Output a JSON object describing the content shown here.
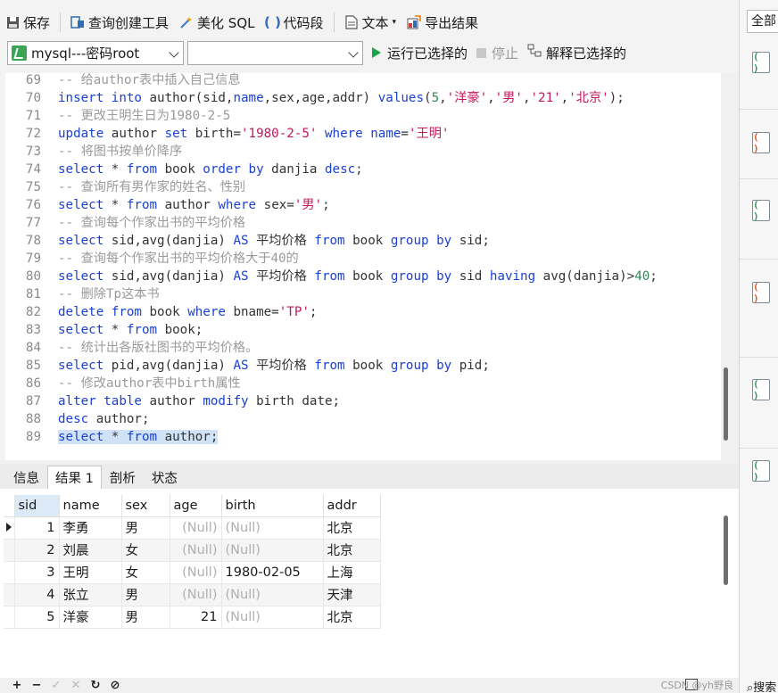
{
  "toolbar": {
    "save": "保存",
    "query_builder": "查询创建工具",
    "beautify_sql": "美化 SQL",
    "code_snippet": "代码段",
    "text": "文本",
    "export_result": "导出结果",
    "connection": "mysql---密码root",
    "database": "",
    "run_selected": "运行已选择的",
    "stop": "停止",
    "explain_selected": "解释已选择的"
  },
  "editor": {
    "lines": [
      {
        "n": "69",
        "tokens": [
          {
            "t": "-- 给author表中插入自己信息",
            "c": "cm"
          }
        ]
      },
      {
        "n": "70",
        "tokens": [
          {
            "t": "insert",
            "c": "kw"
          },
          {
            "t": " ",
            "c": "id"
          },
          {
            "t": "into",
            "c": "kw"
          },
          {
            "t": " author(sid,",
            "c": "id"
          },
          {
            "t": "name",
            "c": "kw"
          },
          {
            "t": ",sex,age,addr) ",
            "c": "id"
          },
          {
            "t": "values",
            "c": "kw"
          },
          {
            "t": "(",
            "c": "id"
          },
          {
            "t": "5",
            "c": "num"
          },
          {
            "t": ",",
            "c": "id"
          },
          {
            "t": "'洋豪'",
            "c": "str"
          },
          {
            "t": ",",
            "c": "id"
          },
          {
            "t": "'男'",
            "c": "str"
          },
          {
            "t": ",",
            "c": "id"
          },
          {
            "t": "'21'",
            "c": "str"
          },
          {
            "t": ",",
            "c": "id"
          },
          {
            "t": "'北京'",
            "c": "str"
          },
          {
            "t": ");",
            "c": "id"
          }
        ]
      },
      {
        "n": "71",
        "tokens": [
          {
            "t": "-- 更改王明生日为1980-2-5",
            "c": "cm"
          }
        ]
      },
      {
        "n": "72",
        "tokens": [
          {
            "t": "update",
            "c": "kw"
          },
          {
            "t": " author ",
            "c": "id"
          },
          {
            "t": "set",
            "c": "kw"
          },
          {
            "t": " birth=",
            "c": "id"
          },
          {
            "t": "'1980-2-5'",
            "c": "str"
          },
          {
            "t": " ",
            "c": "id"
          },
          {
            "t": "where",
            "c": "kw"
          },
          {
            "t": " ",
            "c": "id"
          },
          {
            "t": "name",
            "c": "kw"
          },
          {
            "t": "=",
            "c": "id"
          },
          {
            "t": "'王明'",
            "c": "str"
          }
        ]
      },
      {
        "n": "73",
        "tokens": [
          {
            "t": "-- 将图书按单价降序",
            "c": "cm"
          }
        ]
      },
      {
        "n": "74",
        "tokens": [
          {
            "t": "select",
            "c": "kw"
          },
          {
            "t": " * ",
            "c": "id"
          },
          {
            "t": "from",
            "c": "kw"
          },
          {
            "t": " book ",
            "c": "id"
          },
          {
            "t": "order by",
            "c": "kw"
          },
          {
            "t": " danjia ",
            "c": "id"
          },
          {
            "t": "desc",
            "c": "kw"
          },
          {
            "t": ";",
            "c": "id"
          }
        ]
      },
      {
        "n": "75",
        "tokens": [
          {
            "t": "-- 查询所有男作家的姓名、性别",
            "c": "cm"
          }
        ]
      },
      {
        "n": "76",
        "tokens": [
          {
            "t": "select",
            "c": "kw"
          },
          {
            "t": " * ",
            "c": "id"
          },
          {
            "t": "from",
            "c": "kw"
          },
          {
            "t": " author ",
            "c": "id"
          },
          {
            "t": "where",
            "c": "kw"
          },
          {
            "t": " sex=",
            "c": "id"
          },
          {
            "t": "'男'",
            "c": "str"
          },
          {
            "t": ";",
            "c": "id"
          }
        ]
      },
      {
        "n": "77",
        "tokens": [
          {
            "t": "-- 查询每个作家出书的平均价格",
            "c": "cm"
          }
        ]
      },
      {
        "n": "78",
        "tokens": [
          {
            "t": "select",
            "c": "kw"
          },
          {
            "t": " sid,avg(danjia) ",
            "c": "id"
          },
          {
            "t": "AS",
            "c": "kw"
          },
          {
            "t": " 平均价格 ",
            "c": "id"
          },
          {
            "t": "from",
            "c": "kw"
          },
          {
            "t": " book ",
            "c": "id"
          },
          {
            "t": "group by",
            "c": "kw"
          },
          {
            "t": " sid;",
            "c": "id"
          }
        ]
      },
      {
        "n": "79",
        "tokens": [
          {
            "t": "-- 查询每个作家出书的平均价格大于40的",
            "c": "cm"
          }
        ]
      },
      {
        "n": "80",
        "tokens": [
          {
            "t": "select",
            "c": "kw"
          },
          {
            "t": " sid,avg(danjia) ",
            "c": "id"
          },
          {
            "t": "AS",
            "c": "kw"
          },
          {
            "t": " 平均价格 ",
            "c": "id"
          },
          {
            "t": "from",
            "c": "kw"
          },
          {
            "t": " book ",
            "c": "id"
          },
          {
            "t": "group by",
            "c": "kw"
          },
          {
            "t": " sid ",
            "c": "id"
          },
          {
            "t": "having",
            "c": "kw"
          },
          {
            "t": " avg(danjia)>",
            "c": "id"
          },
          {
            "t": "40",
            "c": "num"
          },
          {
            "t": ";",
            "c": "id"
          }
        ]
      },
      {
        "n": "81",
        "tokens": [
          {
            "t": "-- 删除Tp这本书",
            "c": "cm"
          }
        ]
      },
      {
        "n": "82",
        "tokens": [
          {
            "t": "delete",
            "c": "kw"
          },
          {
            "t": " ",
            "c": "id"
          },
          {
            "t": "from",
            "c": "kw"
          },
          {
            "t": " book ",
            "c": "id"
          },
          {
            "t": "where",
            "c": "kw"
          },
          {
            "t": " bname=",
            "c": "id"
          },
          {
            "t": "'TP'",
            "c": "str"
          },
          {
            "t": ";",
            "c": "id"
          }
        ]
      },
      {
        "n": "83",
        "tokens": [
          {
            "t": "select",
            "c": "kw"
          },
          {
            "t": " * ",
            "c": "id"
          },
          {
            "t": "from",
            "c": "kw"
          },
          {
            "t": " book;",
            "c": "id"
          }
        ]
      },
      {
        "n": "84",
        "tokens": [
          {
            "t": "-- 统计出各版社图书的平均价格。",
            "c": "cm"
          }
        ]
      },
      {
        "n": "85",
        "tokens": [
          {
            "t": "select",
            "c": "kw"
          },
          {
            "t": " pid,avg(danjia) ",
            "c": "id"
          },
          {
            "t": "AS",
            "c": "kw"
          },
          {
            "t": " 平均价格 ",
            "c": "id"
          },
          {
            "t": "from",
            "c": "kw"
          },
          {
            "t": " book ",
            "c": "id"
          },
          {
            "t": "group by",
            "c": "kw"
          },
          {
            "t": " pid;",
            "c": "id"
          }
        ]
      },
      {
        "n": "86",
        "tokens": [
          {
            "t": "-- 修改author表中birth属性",
            "c": "cm"
          }
        ]
      },
      {
        "n": "87",
        "tokens": [
          {
            "t": "alter",
            "c": "kw"
          },
          {
            "t": " ",
            "c": "id"
          },
          {
            "t": "table",
            "c": "kw"
          },
          {
            "t": " author ",
            "c": "id"
          },
          {
            "t": "modify",
            "c": "kw"
          },
          {
            "t": " birth date;",
            "c": "id"
          }
        ]
      },
      {
        "n": "88",
        "tokens": [
          {
            "t": "desc",
            "c": "kw"
          },
          {
            "t": " author;",
            "c": "id"
          }
        ]
      },
      {
        "n": "89",
        "selected": true,
        "tokens": [
          {
            "t": "select",
            "c": "kw"
          },
          {
            "t": " * ",
            "c": "id"
          },
          {
            "t": "from",
            "c": "kw"
          },
          {
            "t": " author;",
            "c": "id"
          }
        ]
      }
    ]
  },
  "result_tabs": [
    {
      "label": "信息",
      "active": false
    },
    {
      "label": "结果 1",
      "active": true
    },
    {
      "label": "剖析",
      "active": false
    },
    {
      "label": "状态",
      "active": false
    }
  ],
  "grid": {
    "columns": [
      "sid",
      "name",
      "sex",
      "age",
      "birth",
      "addr"
    ],
    "rows": [
      [
        "1",
        "李勇",
        "男",
        "(Null)",
        "(Null)",
        "北京"
      ],
      [
        "2",
        "刘晨",
        "女",
        "(Null)",
        "(Null)",
        "北京"
      ],
      [
        "3",
        "王明",
        "女",
        "(Null)",
        "1980-02-05",
        "上海"
      ],
      [
        "4",
        "张立",
        "男",
        "(Null)",
        "(Null)",
        "天津"
      ],
      [
        "5",
        "洋豪",
        "男",
        "21",
        "(Null)",
        "北京"
      ]
    ]
  },
  "bottom": {
    "add": "+",
    "remove": "−",
    "apply": "✓",
    "discard": "✕",
    "refresh": "↻",
    "stop": "⊘",
    "watermark": "CSDN @yh野良"
  },
  "right_panel": {
    "filter": "全部",
    "search": "搜索"
  }
}
